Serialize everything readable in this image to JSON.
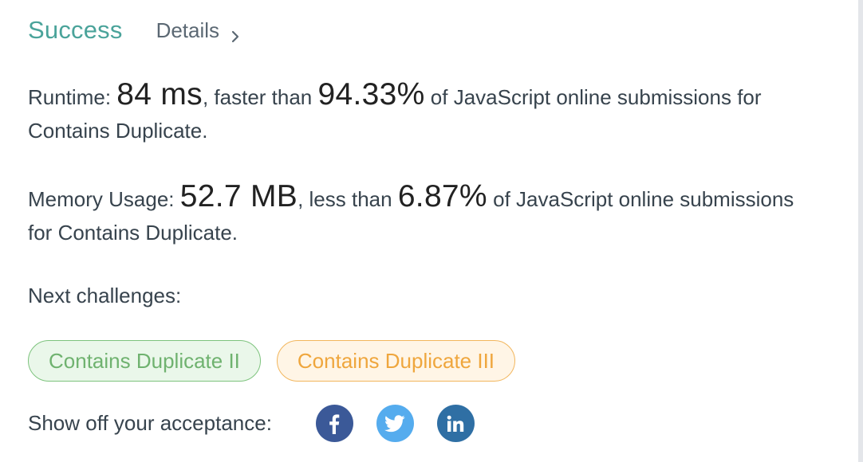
{
  "result": {
    "status_label": "Success",
    "details_label": "Details"
  },
  "runtime": {
    "label": "Runtime: ",
    "value": "84 ms",
    "connector": ", faster than ",
    "percent": "94.33%",
    "suffix": " of JavaScript online submissions for Contains Duplicate."
  },
  "memory": {
    "label": "Memory Usage: ",
    "value": "52.7 MB",
    "connector": ", less than ",
    "percent": "6.87%",
    "suffix": " of JavaScript online submissions for Contains Duplicate."
  },
  "next": {
    "label": "Next challenges:",
    "challenges": [
      {
        "title": "Contains Duplicate II",
        "difficulty_color": "#6fb26f"
      },
      {
        "title": "Contains Duplicate III",
        "difficulty_color": "#efa63d"
      }
    ]
  },
  "share": {
    "label": "Show off your acceptance:",
    "icons": [
      "facebook-icon",
      "twitter-icon",
      "linkedin-icon"
    ]
  },
  "colors": {
    "success": "#4aa39a",
    "facebook": "#3b5998",
    "twitter": "#55acee",
    "linkedin": "#2f6fa4"
  }
}
